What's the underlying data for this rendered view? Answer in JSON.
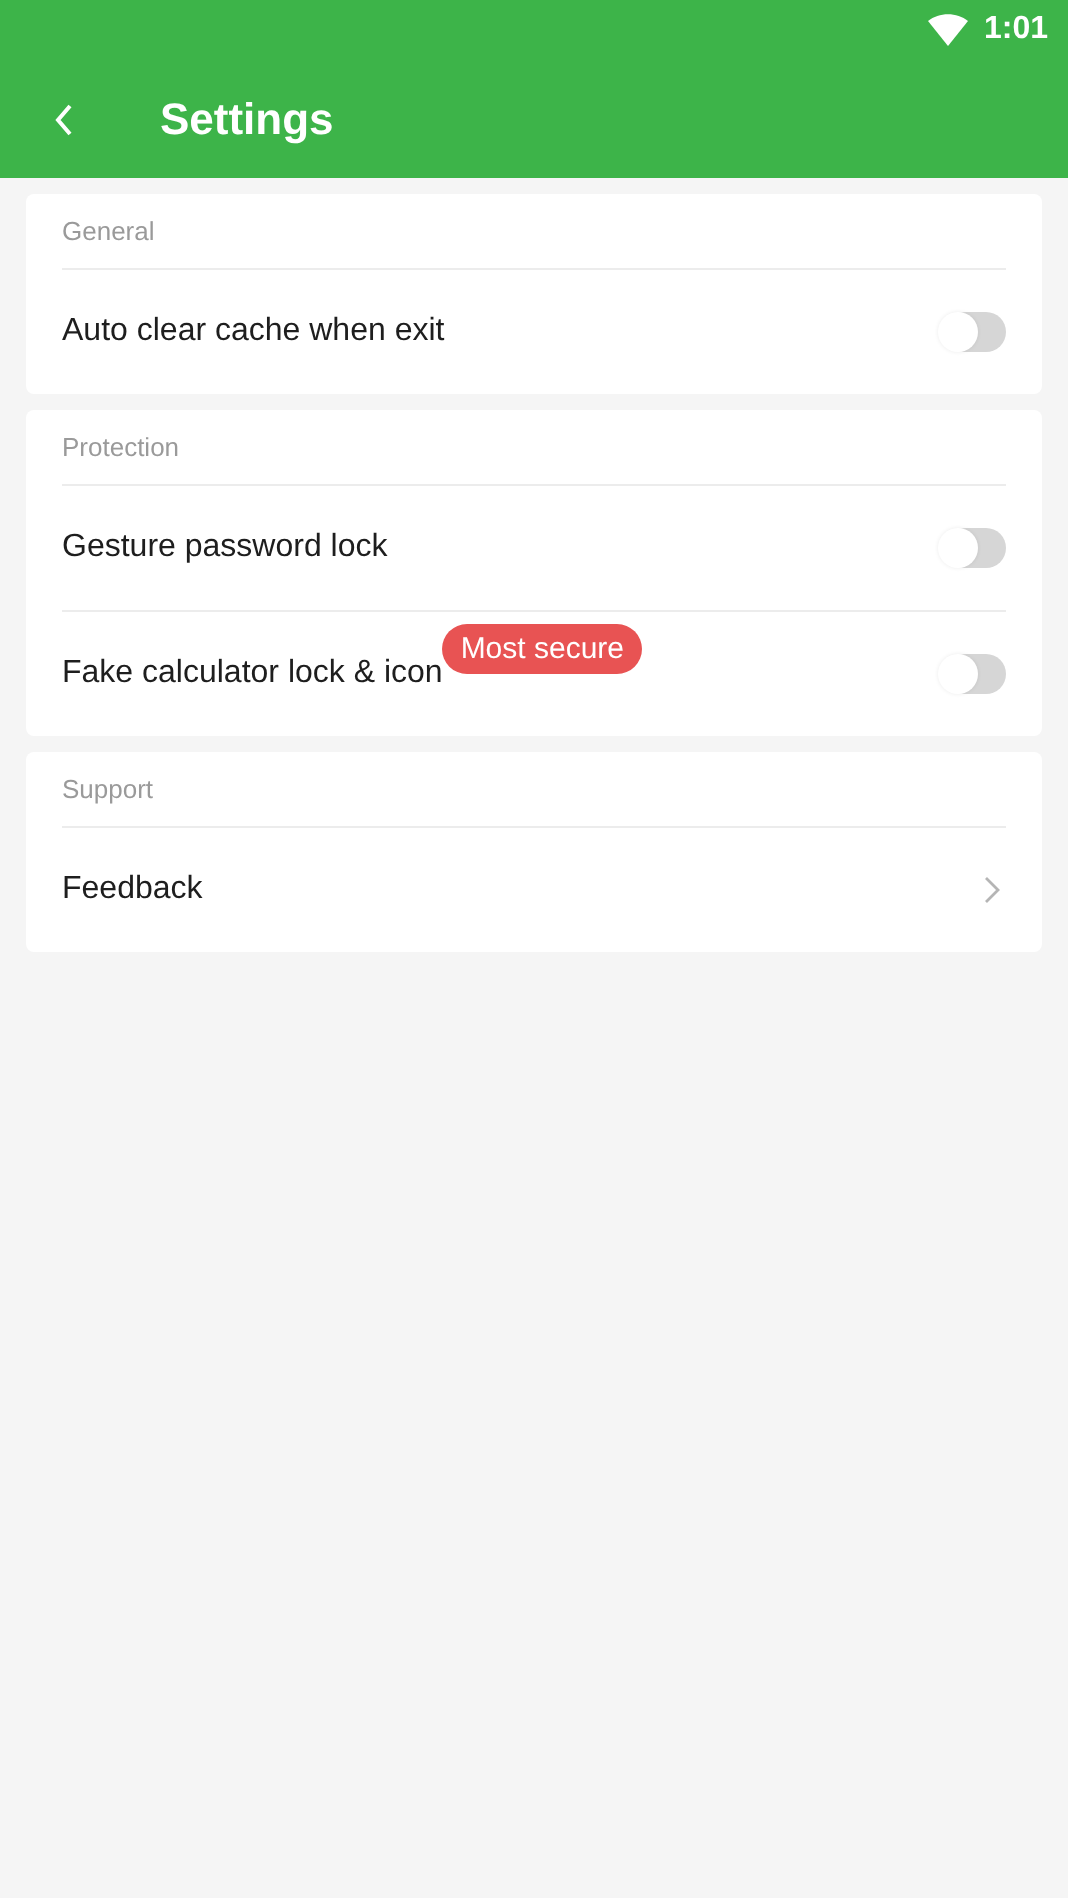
{
  "status_bar": {
    "time": "1:01"
  },
  "app_bar": {
    "title": "Settings"
  },
  "sections": [
    {
      "header": "General",
      "items": [
        {
          "kind": "toggle",
          "label": "Auto clear cache when exit",
          "on": false
        }
      ]
    },
    {
      "header": "Protection",
      "items": [
        {
          "kind": "toggle",
          "label": "Gesture password lock",
          "on": false
        },
        {
          "kind": "toggle",
          "label": "Fake calculator lock & icon",
          "on": false,
          "badge": "Most secure"
        }
      ]
    },
    {
      "header": "Support",
      "items": [
        {
          "kind": "link",
          "label": "Feedback"
        }
      ]
    }
  ]
}
